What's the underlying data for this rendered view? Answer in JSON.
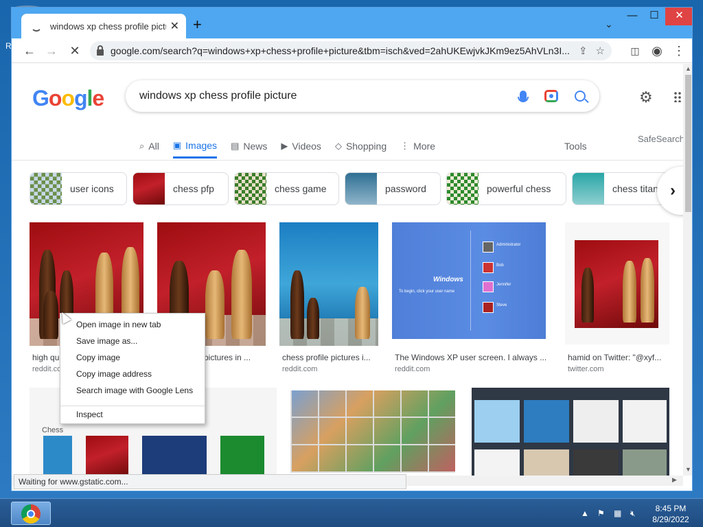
{
  "browser": {
    "tab_title": "windows xp chess profile picture",
    "new_tab_symbol": "+",
    "url": "google.com/search?q=windows+xp+chess+profile+picture&tbm=isch&ved=2ahUKEwjvkJKm9ez5AhVLn3I..."
  },
  "search": {
    "logo": [
      "G",
      "o",
      "o",
      "g",
      "l",
      "e"
    ],
    "logo_colors": [
      "#4285f4",
      "#ea4335",
      "#fbbc05",
      "#4285f4",
      "#34a853",
      "#ea4335"
    ],
    "query": "windows xp chess profile picture"
  },
  "nav": {
    "tabs": [
      {
        "label": "All",
        "icon": "search-icon"
      },
      {
        "label": "Images",
        "icon": "image-icon"
      },
      {
        "label": "News",
        "icon": "news-icon"
      },
      {
        "label": "Videos",
        "icon": "video-icon"
      },
      {
        "label": "Shopping",
        "icon": "tag-icon"
      },
      {
        "label": "More",
        "icon": "more-icon"
      }
    ],
    "tools": "Tools",
    "safesearch": "SafeSearch"
  },
  "chips": [
    {
      "label": "user icons"
    },
    {
      "label": "chess pfp"
    },
    {
      "label": "chess game"
    },
    {
      "label": "password"
    },
    {
      "label": "powerful chess"
    },
    {
      "label": "chess titan"
    }
  ],
  "results": [
    {
      "caption": "high qu",
      "source": "reddit.co"
    },
    {
      "caption": "e pictures in ...",
      "source": ""
    },
    {
      "caption": "chess profile pictures i...",
      "source": "reddit.com"
    },
    {
      "caption": "The Windows XP user screen. I always ...",
      "source": "reddit.com"
    },
    {
      "caption": "hamid on Twitter: \"@xyf...",
      "source": "twitter.com"
    }
  ],
  "xp_screen": {
    "logo_word": "Windows",
    "hint": "To begin, click your user name",
    "users": [
      "Administrator",
      "Bob",
      "Jennifer",
      "Steve"
    ]
  },
  "second_row": {
    "chess_label": "Chess"
  },
  "context_menu": {
    "items": [
      "Open image in new tab",
      "Save image as...",
      "Copy image",
      "Copy image address",
      "Search image with Google Lens",
      "Inspect"
    ]
  },
  "status_text": "Waiting for www.gstatic.com...",
  "taskbar": {
    "time": "8:45 PM",
    "date": "8/29/2022"
  },
  "desktop": {
    "edge_letter": "R"
  }
}
